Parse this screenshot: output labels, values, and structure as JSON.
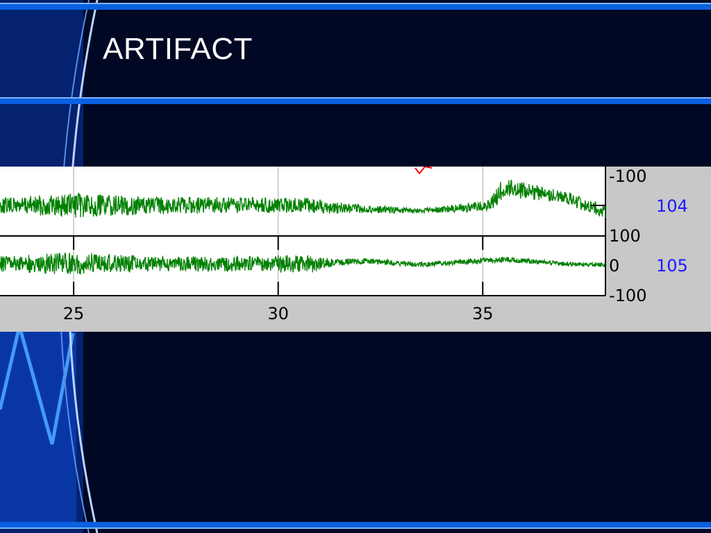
{
  "slide": {
    "title": "ARTIFACT"
  },
  "colors": {
    "background": "#000824",
    "band": "#0a60e0",
    "band_highlight": "#7fb4ff",
    "trace": "#008000",
    "channel_label": "#1a1aff",
    "marker": "#ff0000",
    "panel": "#c8c8c8"
  },
  "chart_data": {
    "type": "line",
    "title": "",
    "xlabel": "",
    "ylabel": "",
    "x_ticks": [
      25,
      30,
      35
    ],
    "xlim": [
      23.2,
      38.0
    ],
    "channels": [
      {
        "name": "104",
        "y_ticks": [
          "-100",
          "100"
        ],
        "profile": [
          [
            23.2,
            18
          ],
          [
            25,
            30
          ],
          [
            27,
            20
          ],
          [
            29,
            20
          ],
          [
            31,
            18
          ],
          [
            32,
            10
          ],
          [
            33.5,
            6
          ],
          [
            35,
            12
          ],
          [
            35.4,
            24
          ],
          [
            37,
            14
          ],
          [
            38,
            18
          ]
        ]
      },
      {
        "name": "105",
        "y_ticks": [
          "100",
          "0",
          "-100"
        ],
        "profile": [
          [
            23.2,
            18
          ],
          [
            25,
            28
          ],
          [
            27,
            18
          ],
          [
            29,
            18
          ],
          [
            30.8,
            22
          ],
          [
            31.4,
            8
          ],
          [
            33.5,
            6
          ],
          [
            35,
            7
          ],
          [
            37,
            5
          ],
          [
            38,
            5
          ]
        ]
      }
    ]
  }
}
